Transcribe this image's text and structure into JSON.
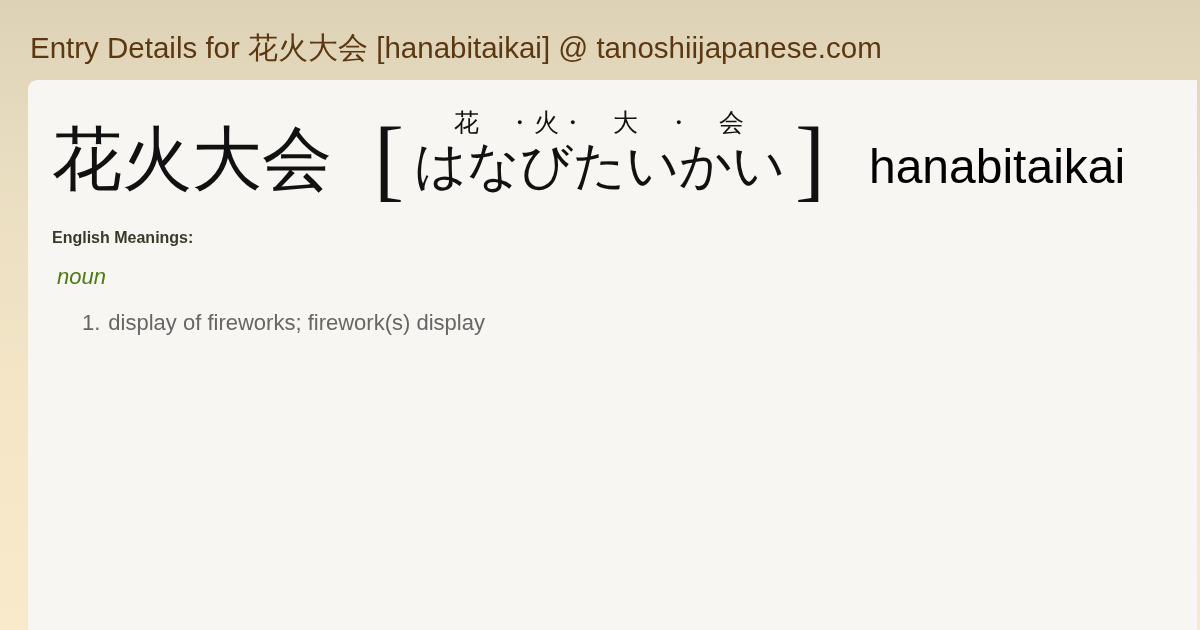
{
  "page": {
    "title": "Entry Details for 花火大会 [hanabitaikai] @ tanoshiijapanese.com"
  },
  "entry": {
    "word": "花火大会",
    "bracket_open": "[",
    "furigana": [
      {
        "kind": "group",
        "kanji": "花",
        "kana": "はな"
      },
      {
        "kind": "separator",
        "text": "・"
      },
      {
        "kind": "group",
        "kanji": "火",
        "kana": "び"
      },
      {
        "kind": "separator",
        "text": "・"
      },
      {
        "kind": "group",
        "kanji": "大",
        "kana": "たい"
      },
      {
        "kind": "separator",
        "text": "・"
      },
      {
        "kind": "group",
        "kanji": "会",
        "kana": "かい"
      }
    ],
    "bracket_close": "]",
    "romaji": "hanabitaikai"
  },
  "meanings": {
    "heading": "English Meanings:",
    "groups": [
      {
        "part_of_speech": "noun",
        "senses": [
          {
            "number": "1.",
            "text": "display of fireworks; firework(s) display"
          }
        ]
      }
    ]
  }
}
